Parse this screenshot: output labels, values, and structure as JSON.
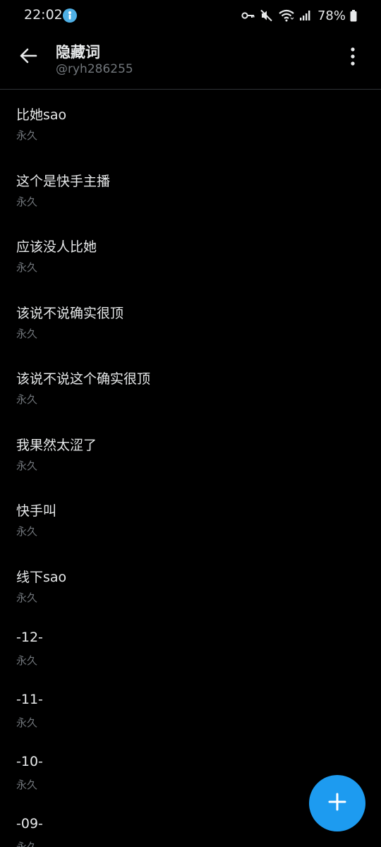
{
  "status_bar": {
    "time": "22:02",
    "battery": "78%",
    "icons": [
      "app-notification-icon",
      "key-icon",
      "mute-icon",
      "wifi-icon",
      "signal-icon",
      "battery-icon"
    ]
  },
  "header": {
    "title": "隐藏词",
    "subtitle": "@ryh286255",
    "back_icon": "arrow-left-icon",
    "more_icon": "more-vertical-icon"
  },
  "muted_words": [
    {
      "word": "比她sao",
      "duration": "永久"
    },
    {
      "word": "这个是快手主播",
      "duration": "永久"
    },
    {
      "word": "应该没人比她",
      "duration": "永久"
    },
    {
      "word": "该说不说确实很顶",
      "duration": "永久"
    },
    {
      "word": "该说不说这个确实很顶",
      "duration": "永久"
    },
    {
      "word": "我果然太涩了",
      "duration": "永久"
    },
    {
      "word": "快手叫",
      "duration": "永久"
    },
    {
      "word": "线下sao",
      "duration": "永久"
    },
    {
      "word": "-12-",
      "duration": "永久"
    },
    {
      "word": "-11-",
      "duration": "永久"
    },
    {
      "word": "-10-",
      "duration": "永久"
    },
    {
      "word": "-09-",
      "duration": "永久"
    }
  ],
  "fab": {
    "icon": "plus-icon"
  },
  "colors": {
    "background": "#000000",
    "primary_text": "#e7e9ea",
    "secondary_text": "#71767b",
    "accent": "#1d9bf0",
    "divider": "#2f3336"
  }
}
